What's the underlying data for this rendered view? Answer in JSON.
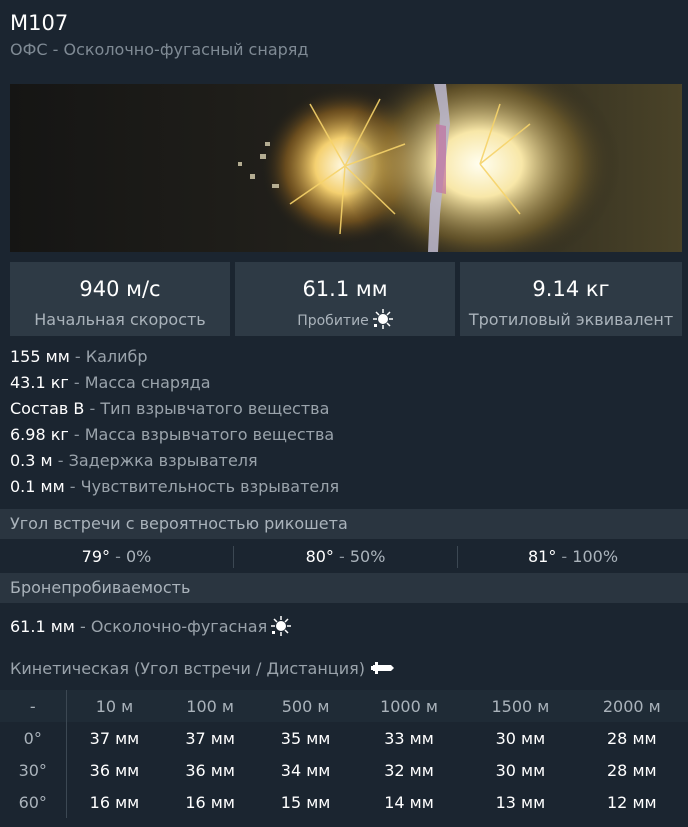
{
  "header": {
    "title": "M107",
    "subtitle": "ОФС - Осколочно-фугасный снаряд"
  },
  "stats": [
    {
      "value": "940 м/с",
      "label": "Начальная скорость"
    },
    {
      "value": "61.1 мм",
      "label": "Пробитие"
    },
    {
      "value": "9.14 кг",
      "label": "Тротиловый эквивалент"
    }
  ],
  "properties": [
    {
      "value": "155 мм",
      "label": "Калибр"
    },
    {
      "value": "43.1 кг",
      "label": "Масса снаряда"
    },
    {
      "value": "Состав B",
      "label": "Тип взрывчатого вещества"
    },
    {
      "value": "6.98 кг",
      "label": "Масса взрывчатого вещества"
    },
    {
      "value": "0.3 м",
      "label": "Задержка взрывателя"
    },
    {
      "value": "0.1 мм",
      "label": "Чувствительность взрывателя"
    }
  ],
  "separator": " - ",
  "ricochet": {
    "title": "Угол встречи с вероятностью рикошета",
    "items": [
      {
        "angle": "79°",
        "chance": "0%"
      },
      {
        "angle": "80°",
        "chance": "50%"
      },
      {
        "angle": "81°",
        "chance": "100%"
      }
    ]
  },
  "armor": {
    "title": "Бронепробиваемость",
    "he_value": "61.1 мм",
    "he_label": "Осколочно-фугасная"
  },
  "kinetic": {
    "title": "Кинетическая (Угол встречи / Дистанция)",
    "corner": "-",
    "distances": [
      "10 м",
      "100 м",
      "500 м",
      "1000 м",
      "1500 м",
      "2000 м"
    ],
    "rows": [
      {
        "angle": "0°",
        "values": [
          "37 мм",
          "37 мм",
          "35 мм",
          "33 мм",
          "30 мм",
          "28 мм"
        ]
      },
      {
        "angle": "30°",
        "values": [
          "36 мм",
          "36 мм",
          "34 мм",
          "32 мм",
          "30 мм",
          "28 мм"
        ]
      },
      {
        "angle": "60°",
        "values": [
          "16 мм",
          "16 мм",
          "15 мм",
          "14 мм",
          "13 мм",
          "12 мм"
        ]
      }
    ]
  },
  "icons": {
    "penetration": "he-burst-icon",
    "kinetic": "shell-icon"
  },
  "colors": {
    "background": "#1b2530",
    "panel": "#2e3a45",
    "section_header": "#2a3540",
    "muted_text": "#9aa3ab"
  }
}
